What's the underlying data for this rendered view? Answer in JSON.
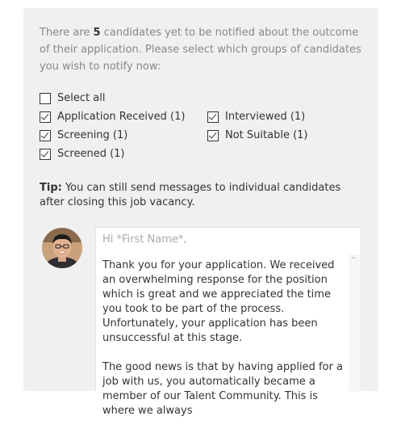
{
  "intro": {
    "prefix": "There are ",
    "count": "5",
    "suffix": " candidates yet to be notified about the outcome of their application. Please select which groups of candidates you wish to notify now:"
  },
  "groups": {
    "select_all": {
      "label": "Select all",
      "checked": false
    },
    "application_received": {
      "label": "Application Received (1)",
      "checked": true
    },
    "screening": {
      "label": "Screening (1)",
      "checked": true
    },
    "screened": {
      "label": "Screened (1)",
      "checked": true
    },
    "interviewed": {
      "label": "Interviewed (1)",
      "checked": true
    },
    "not_suitable": {
      "label": "Not Suitable (1)",
      "checked": true
    }
  },
  "tip": {
    "label": "Tip:",
    "text": " You can still send messages to individual candidates after closing this job vacancy."
  },
  "message": {
    "greeting_placeholder": "Hi *First Name*,",
    "paragraph1": "Thank you for your application. We received an overwhelming response for the position which is great and we appreciated the time you took to be part of the process. Unfortunately, your application has been unsuccessful at this stage.",
    "paragraph2": "The good news is that by having applied for a job with us, you automatically became a member of our Talent Community. This is where we always"
  },
  "icons": {
    "checkbox_checked": "checkbox-checked-icon",
    "checkbox_unchecked": "checkbox-empty-icon",
    "scroll_up": "chevron-up-icon"
  }
}
